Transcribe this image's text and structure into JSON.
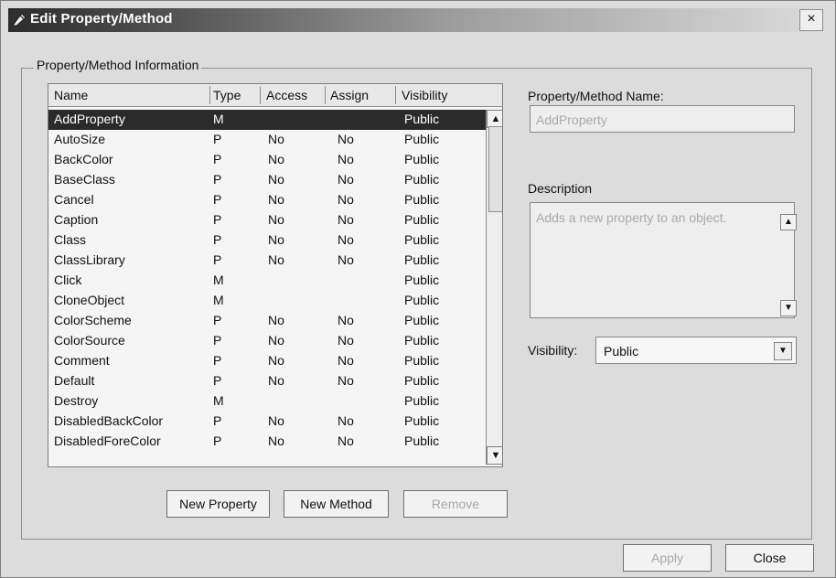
{
  "window": {
    "title": "Edit Property/Method",
    "close_symbol": "×",
    "title_icon": "edit-icon"
  },
  "group": {
    "label": "Property/Method Information"
  },
  "list": {
    "columns": [
      "Name",
      "Type",
      "Access",
      "Assign",
      "Visibility"
    ],
    "rows": [
      {
        "name": "AddProperty",
        "type": "M",
        "access": "",
        "assign": "",
        "visibility": "Public"
      },
      {
        "name": "AutoSize",
        "type": "P",
        "access": "No",
        "assign": "No",
        "visibility": "Public"
      },
      {
        "name": "BackColor",
        "type": "P",
        "access": "No",
        "assign": "No",
        "visibility": "Public"
      },
      {
        "name": "BaseClass",
        "type": "P",
        "access": "No",
        "assign": "No",
        "visibility": "Public"
      },
      {
        "name": "Cancel",
        "type": "P",
        "access": "No",
        "assign": "No",
        "visibility": "Public"
      },
      {
        "name": "Caption",
        "type": "P",
        "access": "No",
        "assign": "No",
        "visibility": "Public"
      },
      {
        "name": "Class",
        "type": "P",
        "access": "No",
        "assign": "No",
        "visibility": "Public"
      },
      {
        "name": "ClassLibrary",
        "type": "P",
        "access": "No",
        "assign": "No",
        "visibility": "Public"
      },
      {
        "name": "Click",
        "type": "M",
        "access": "",
        "assign": "",
        "visibility": "Public"
      },
      {
        "name": "CloneObject",
        "type": "M",
        "access": "",
        "assign": "",
        "visibility": "Public"
      },
      {
        "name": "ColorScheme",
        "type": "P",
        "access": "No",
        "assign": "No",
        "visibility": "Public"
      },
      {
        "name": "ColorSource",
        "type": "P",
        "access": "No",
        "assign": "No",
        "visibility": "Public"
      },
      {
        "name": "Comment",
        "type": "P",
        "access": "No",
        "assign": "No",
        "visibility": "Public"
      },
      {
        "name": "Default",
        "type": "P",
        "access": "No",
        "assign": "No",
        "visibility": "Public"
      },
      {
        "name": "Destroy",
        "type": "M",
        "access": "",
        "assign": "",
        "visibility": "Public"
      },
      {
        "name": "DisabledBackColor",
        "type": "P",
        "access": "No",
        "assign": "No",
        "visibility": "Public"
      },
      {
        "name": "DisabledForeColor",
        "type": "P",
        "access": "No",
        "assign": "No",
        "visibility": "Public"
      }
    ],
    "scroll_up": "▲",
    "scroll_down": "▼"
  },
  "buttons": {
    "new_property": "New Property",
    "new_method": "New Method",
    "remove": "Remove",
    "apply": "Apply",
    "close": "Close"
  },
  "form": {
    "name_label": "Property/Method Name:",
    "name_value": "AddProperty",
    "description_label": "Description",
    "description_value": "Adds a new property to an object.",
    "visibility_label": "Visibility:",
    "visibility_value": "Public"
  }
}
